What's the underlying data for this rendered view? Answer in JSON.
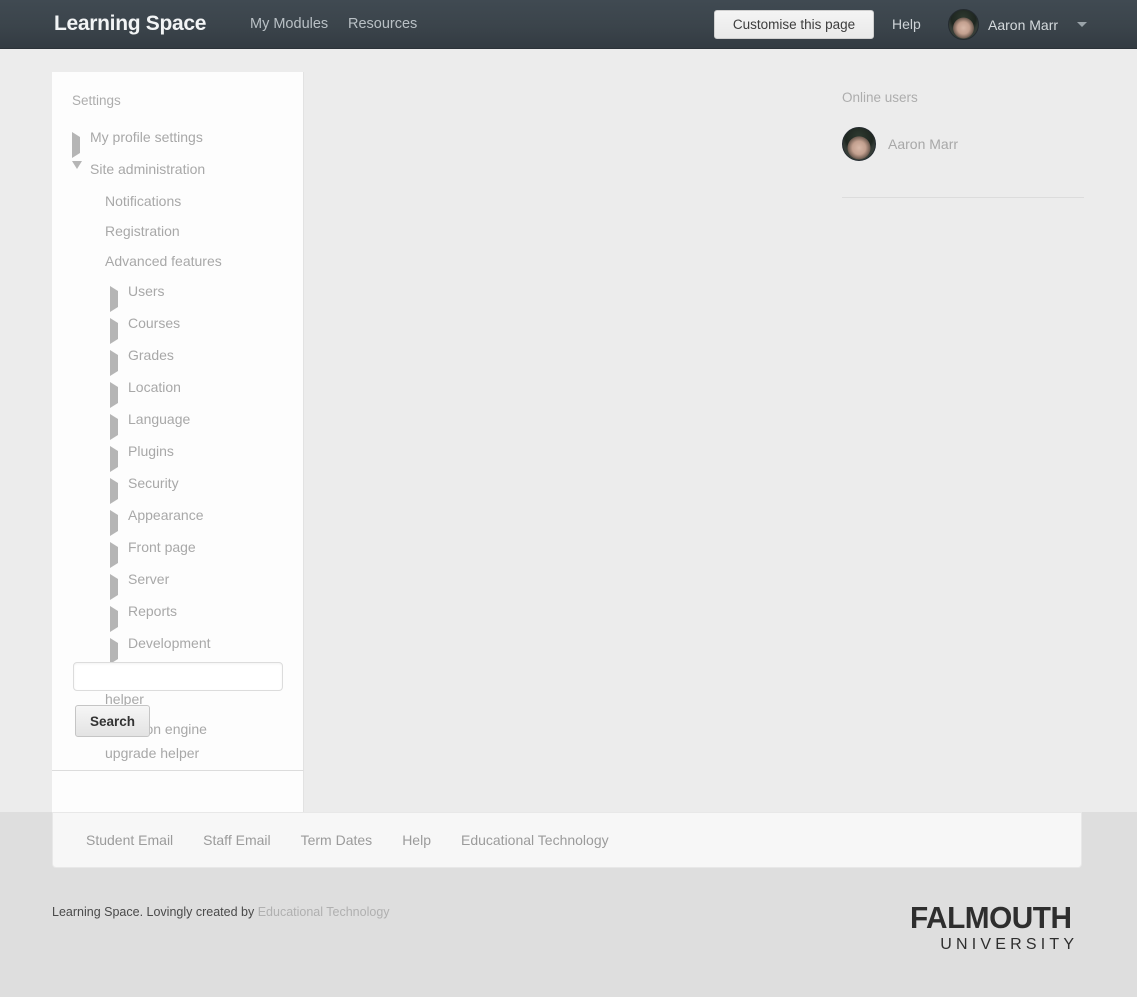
{
  "header": {
    "logo": "Learning Space",
    "nav": [
      {
        "label": "My Modules"
      },
      {
        "label": "Resources"
      }
    ],
    "customise_button": "Customise this page",
    "help_label": "Help",
    "user_name": "Aaron Marr",
    "avatar_icon": "user-avatar",
    "caret_icon": "chevron-down-icon",
    "bg_color": "#3b444b"
  },
  "sidebar": {
    "title": "Settings",
    "items": [
      {
        "label": "My profile settings",
        "level": 0,
        "state": "collapsed",
        "marker": "triangle-right-icon"
      },
      {
        "label": "Site administration",
        "level": 0,
        "state": "expanded",
        "marker": "triangle-down-icon"
      },
      {
        "label": "Notifications",
        "level": 1,
        "state": "leaf",
        "marker": ""
      },
      {
        "label": "Registration",
        "level": 1,
        "state": "leaf",
        "marker": ""
      },
      {
        "label": "Advanced features",
        "level": 1,
        "state": "leaf",
        "marker": ""
      },
      {
        "label": "Users",
        "level": 1,
        "state": "collapsed",
        "marker": "triangle-right-icon"
      },
      {
        "label": "Courses",
        "level": 1,
        "state": "collapsed",
        "marker": "triangle-right-icon"
      },
      {
        "label": "Grades",
        "level": 1,
        "state": "collapsed",
        "marker": "triangle-right-icon"
      },
      {
        "label": "Location",
        "level": 1,
        "state": "collapsed",
        "marker": "triangle-right-icon"
      },
      {
        "label": "Language",
        "level": 1,
        "state": "collapsed",
        "marker": "triangle-right-icon"
      },
      {
        "label": "Plugins",
        "level": 1,
        "state": "collapsed",
        "marker": "triangle-right-icon"
      },
      {
        "label": "Security",
        "level": 1,
        "state": "collapsed",
        "marker": "triangle-right-icon"
      },
      {
        "label": "Appearance",
        "level": 1,
        "state": "collapsed",
        "marker": "triangle-right-icon"
      },
      {
        "label": "Front page",
        "level": 1,
        "state": "collapsed",
        "marker": "triangle-right-icon"
      },
      {
        "label": "Server",
        "level": 1,
        "state": "collapsed",
        "marker": "triangle-right-icon"
      },
      {
        "label": "Reports",
        "level": 1,
        "state": "collapsed",
        "marker": "triangle-right-icon"
      },
      {
        "label": "Development",
        "level": 1,
        "state": "collapsed",
        "marker": "triangle-right-icon"
      },
      {
        "label": "Assignment upgrade helper",
        "level": 1,
        "state": "leaf",
        "marker": ""
      },
      {
        "label": "Question engine upgrade helper",
        "level": 1,
        "state": "leaf",
        "marker": ""
      }
    ],
    "search": {
      "value": "",
      "placeholder": "",
      "button_label": "Search"
    }
  },
  "right_column": {
    "title": "Online users",
    "users": [
      {
        "name": "Aaron Marr",
        "avatar_icon": "user-avatar"
      }
    ]
  },
  "footer": {
    "links": [
      {
        "label": "Student Email"
      },
      {
        "label": "Staff Email"
      },
      {
        "label": "Term Dates"
      },
      {
        "label": "Help"
      },
      {
        "label": "Educational Technology"
      }
    ],
    "credit_text": "Learning Space. Lovingly created by",
    "credit_link": "Educational Technology",
    "brand_line1": "FALMOUTH",
    "brand_line2": "UNIVERSITY"
  }
}
